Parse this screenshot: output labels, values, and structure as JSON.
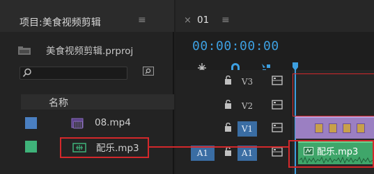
{
  "project": {
    "title": "项目:美食视频剪辑",
    "menu_glyph": "≡",
    "file": "美食视频剪辑.prproj",
    "list_header": "名称",
    "items": [
      {
        "name": "08.mp4",
        "color": "#4a7fc1"
      },
      {
        "name": "配乐.mp3",
        "color": "#3fb37a"
      }
    ]
  },
  "sequence": {
    "close_glyph": "×",
    "name": "01",
    "menu_glyph": "≡",
    "timecode": "00:00:00:00"
  },
  "tracks": [
    {
      "label": "V3",
      "active": false
    },
    {
      "label": "V2",
      "active": false
    },
    {
      "label": "V1",
      "active": true
    },
    {
      "label": "A1",
      "active": true,
      "source_patch": "A1"
    }
  ],
  "clips": {
    "audio_name": "配乐.mp3"
  },
  "colors": {
    "timecode": "#3d9fe0",
    "highlight": "#d4282b",
    "video_clip": "#9b7fc2",
    "audio_clip": "#3fa66a",
    "track_active": "#3a6da3"
  }
}
